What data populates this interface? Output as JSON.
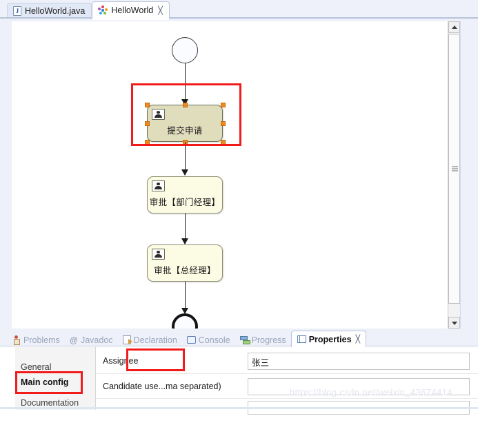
{
  "editor_tabs": [
    {
      "label": "HelloWorld.java",
      "icon": "java-file-icon",
      "active": false,
      "closable": false
    },
    {
      "label": "HelloWorld",
      "icon": "activiti-diagram-icon",
      "active": true,
      "closable": true,
      "close_glyph": "╳"
    }
  ],
  "diagram": {
    "start_event": {
      "name": "start-event",
      "shape": "circle"
    },
    "end_event": {
      "name": "end-event",
      "shape": "thick-circle"
    },
    "tasks": [
      {
        "label": "提交申请",
        "type": "user-task",
        "selected": true,
        "fill": "#dfddbc",
        "stroke": "#6f6f55"
      },
      {
        "label": "审批【部门经理】",
        "type": "user-task",
        "selected": false,
        "fill": "#fcfbe3",
        "stroke": "#8d8d6e"
      },
      {
        "label": "审批【总经理】",
        "type": "user-task",
        "selected": false,
        "fill": "#fcfbe3",
        "stroke": "#8d8d6e"
      }
    ],
    "annotation_color": "#f21b1b",
    "selection_handle_color": "#f08a1e"
  },
  "scrollbar": {
    "up_arrow": "scroll-up-arrow",
    "down_arrow": "scroll-down-arrow"
  },
  "view_tabs": [
    {
      "label": "Problems",
      "icon": "problems-icon",
      "active": false
    },
    {
      "label": "Javadoc",
      "icon": "javadoc-at-icon",
      "active": false
    },
    {
      "label": "Declaration",
      "icon": "declaration-icon",
      "active": false
    },
    {
      "label": "Console",
      "icon": "console-icon",
      "active": false
    },
    {
      "label": "Progress",
      "icon": "progress-icon",
      "active": false
    },
    {
      "label": "Properties",
      "icon": "properties-icon",
      "active": true,
      "close_glyph": "╳"
    }
  ],
  "properties": {
    "sections": [
      {
        "label": "General",
        "active": false
      },
      {
        "label": "Main config",
        "active": true
      },
      {
        "label": "Documentation",
        "active": false
      }
    ],
    "fields": [
      {
        "label": "Assignee",
        "value": "张三",
        "placeholder": ""
      },
      {
        "label": "Candidate use...ma separated)",
        "value": "",
        "placeholder": ""
      },
      {
        "label": "",
        "value": "",
        "placeholder": ""
      }
    ]
  },
  "watermark": "https://blog.csdn.net/weixin_43674414"
}
